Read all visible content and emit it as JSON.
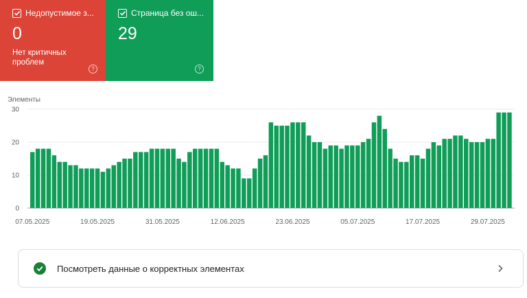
{
  "tiles": [
    {
      "label": "Недопустимое з...",
      "count": "0",
      "description": "Нет критичных проблем",
      "color": "#db4437",
      "icon": "checkbox-checked-icon"
    },
    {
      "label": "Страница без ош...",
      "count": "29",
      "description": "",
      "color": "#0f9d58",
      "icon": "checkbox-checked-icon"
    }
  ],
  "chart_data": {
    "type": "bar",
    "ylabel": "Элементы",
    "ylim": [
      0,
      30
    ],
    "yticks": [
      0,
      10,
      20,
      30
    ],
    "grid": true,
    "bar_color": "#0f9d58",
    "x_tick_labels": [
      "07.05.2025",
      "19.05.2025",
      "31.05.2025",
      "12.06.2025",
      "23.06.2025",
      "05.07.2025",
      "17.07.2025",
      "29.07.2025"
    ],
    "values": [
      17,
      18,
      18,
      18,
      16,
      14,
      14,
      13,
      13,
      12,
      12,
      12,
      12,
      11,
      12,
      13,
      14,
      15,
      15,
      17,
      17,
      17,
      18,
      18,
      18,
      18,
      18,
      15,
      14,
      17,
      18,
      18,
      18,
      18,
      18,
      14,
      13,
      12,
      12,
      9,
      9,
      12,
      15,
      16,
      26,
      25,
      25,
      25,
      26,
      26,
      26,
      22,
      20,
      20,
      18,
      19,
      19,
      18,
      19,
      19,
      19,
      20,
      21,
      26,
      28,
      24,
      18,
      15,
      14,
      14,
      16,
      16,
      15,
      18,
      20,
      19,
      21,
      21,
      22,
      22,
      21,
      20,
      20,
      20,
      21,
      21,
      29,
      29,
      29
    ]
  },
  "valid_items_link": {
    "label": "Посмотреть данные о корректных элементах",
    "icon": "check-circle-icon",
    "chevron": "chevron-right-icon"
  }
}
